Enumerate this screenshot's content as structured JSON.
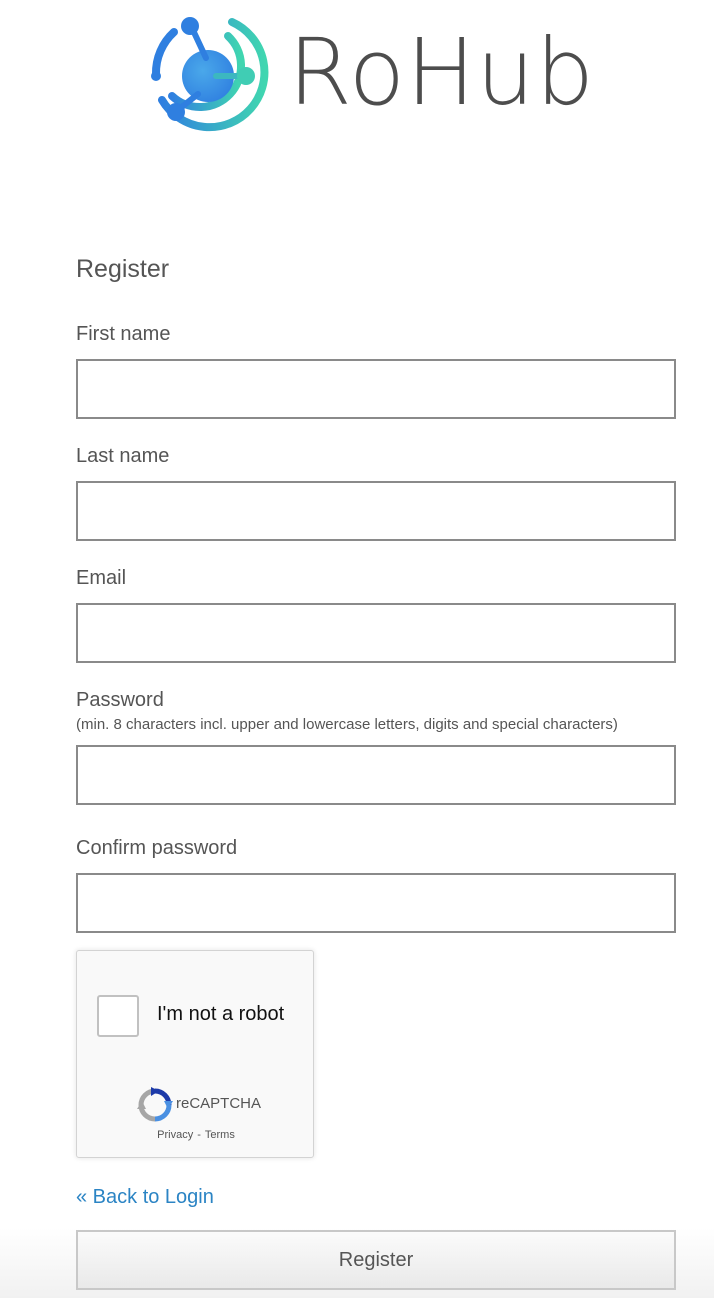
{
  "brand": {
    "name": "RoHub",
    "logo_icon": "rohub-orbit-logo-icon",
    "colors": {
      "gradient_start": "#2f7fe0",
      "gradient_end": "#40d6b0",
      "wordmark": "#4d4d4d"
    }
  },
  "form": {
    "title": "Register",
    "fields": {
      "first_name": {
        "label": "First name",
        "value": "",
        "placeholder": ""
      },
      "last_name": {
        "label": "Last name",
        "value": "",
        "placeholder": ""
      },
      "email": {
        "label": "Email",
        "value": "",
        "placeholder": ""
      },
      "password": {
        "label": "Password",
        "hint": "(min. 8 characters incl. upper and lowercase letters, digits and special characters)",
        "value": "",
        "placeholder": ""
      },
      "confirm_password": {
        "label": "Confirm password",
        "value": "",
        "placeholder": ""
      }
    }
  },
  "captcha": {
    "label": "I'm not a robot",
    "checked": false,
    "brand": "reCAPTCHA",
    "privacy_label": "Privacy",
    "separator": "-",
    "terms_label": "Terms"
  },
  "links": {
    "back_to_login": "« Back to Login"
  },
  "actions": {
    "register_label": "Register"
  },
  "colors": {
    "link": "#2b84c4",
    "input_border": "#8a8a8a",
    "text": "#555555"
  }
}
